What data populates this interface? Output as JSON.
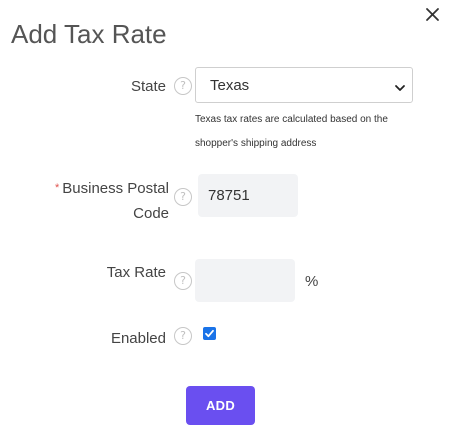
{
  "dialog": {
    "title": "Add Tax Rate",
    "close_icon": "close-icon"
  },
  "state_field": {
    "label": "State",
    "help_icon": "?",
    "selected": "Texas",
    "help_text": "Texas tax rates are calculated based on the shopper's shipping address"
  },
  "postal_field": {
    "required_marker": "*",
    "label_line1": "Business Postal",
    "label_line2": "Code",
    "help_icon": "?",
    "value": "78751"
  },
  "tax_rate_field": {
    "label": "Tax Rate",
    "help_icon": "?",
    "value": "",
    "suffix": "%"
  },
  "enabled_field": {
    "label": "Enabled",
    "help_icon": "?",
    "checked": true
  },
  "actions": {
    "add_label": "ADD"
  },
  "colors": {
    "accent": "#6a4ff0",
    "checkbox": "#1a73e8",
    "required": "#e0524e",
    "input_bg": "#f2f3f5"
  }
}
